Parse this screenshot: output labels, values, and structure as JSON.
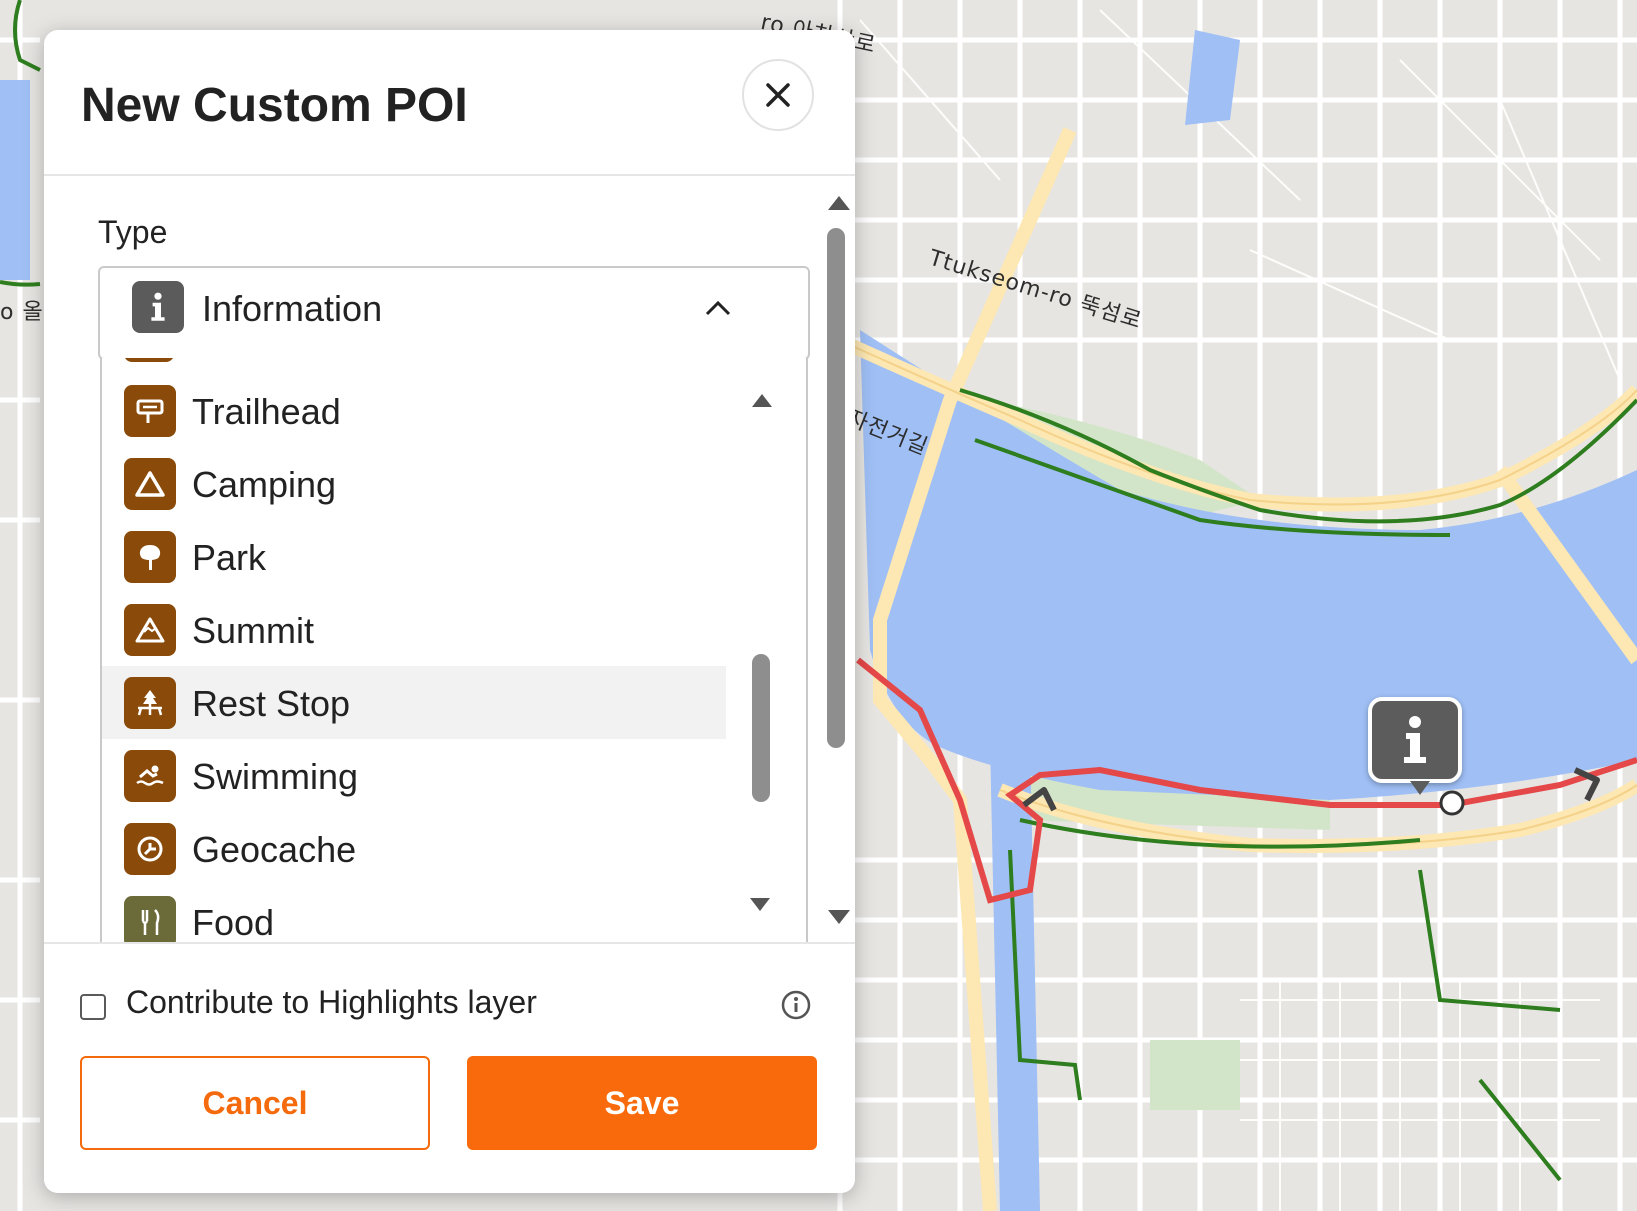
{
  "map": {
    "labels": {
      "ttukseom": "Ttukseom-ro 뚝섬로",
      "achasan": "ro 아차산로",
      "bike_path": "자전거길",
      "left_road": "o 올"
    },
    "marker_icon": "information-icon",
    "colors": {
      "water": "#9fbff5",
      "road": "#fde7b3",
      "park": "#d3e5c8",
      "route": "#e44848",
      "bike": "#2e7d1e"
    }
  },
  "modal": {
    "title": "New Custom POI",
    "close_icon": "close-icon",
    "type_label": "Type",
    "selected_type": {
      "label": "Information",
      "icon": "information-icon"
    },
    "options": [
      {
        "label": "Trailhead",
        "icon": "trailhead-sign-icon"
      },
      {
        "label": "Camping",
        "icon": "tent-icon"
      },
      {
        "label": "Park",
        "icon": "tree-icon"
      },
      {
        "label": "Summit",
        "icon": "mountain-icon"
      },
      {
        "label": "Rest Stop",
        "icon": "picnic-table-icon",
        "highlighted": true
      },
      {
        "label": "Swimming",
        "icon": "swimmer-icon"
      },
      {
        "label": "Geocache",
        "icon": "geocache-icon"
      },
      {
        "label": "Food",
        "icon": "fork-knife-icon"
      }
    ],
    "checkbox_label": "Contribute to Highlights layer",
    "checkbox_checked": false,
    "cancel_label": "Cancel",
    "save_label": "Save",
    "accent_color": "#f96a0c",
    "option_icon_color": "#8a4a0a"
  }
}
